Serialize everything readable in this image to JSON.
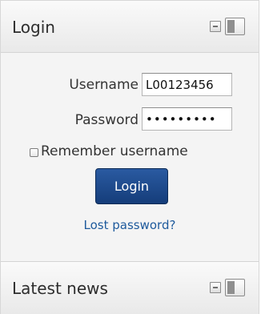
{
  "login_block": {
    "title": "Login",
    "controls": {
      "hide_icon": "minus-box-icon",
      "dock_icon": "dock-panel-icon"
    },
    "form": {
      "username_label": "Username",
      "username_value": "L00123456",
      "password_label": "Password",
      "password_value": "•••••••••",
      "remember_label": "Remember username",
      "remember_checked": false,
      "submit_label": "Login",
      "lost_password_label": "Lost password?"
    }
  },
  "news_block": {
    "title": "Latest news",
    "controls": {
      "hide_icon": "minus-box-icon",
      "dock_icon": "dock-panel-icon"
    }
  },
  "colors": {
    "button": "#1f4b8e",
    "link": "#1e5a9c"
  }
}
